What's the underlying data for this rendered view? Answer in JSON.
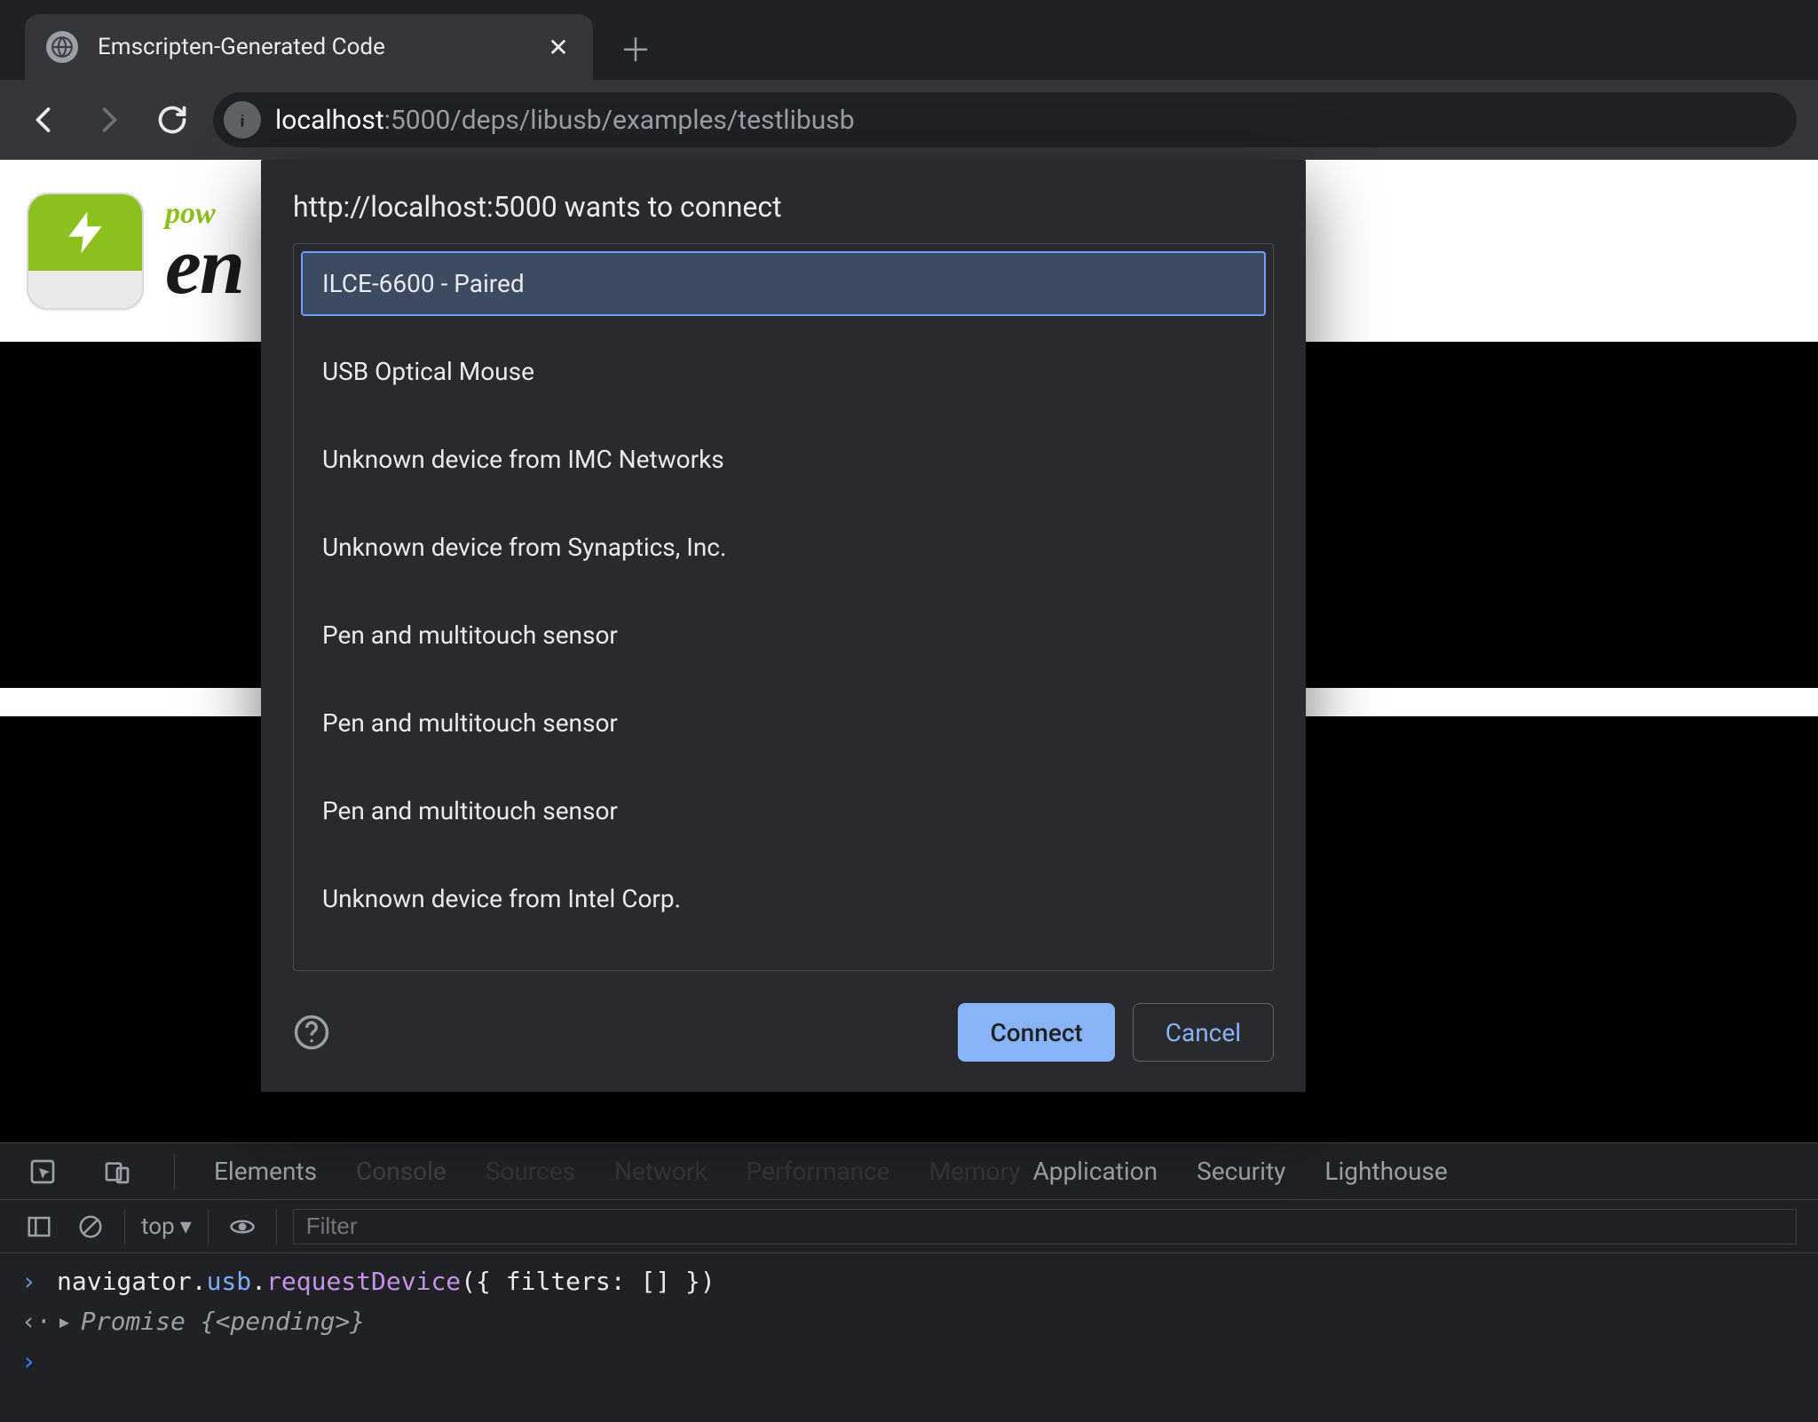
{
  "tab": {
    "title": "Emscripten-Generated Code"
  },
  "url": {
    "host": "localhost",
    "port_path": ":5000/deps/libusb/examples/testlibusb"
  },
  "page": {
    "powered_prefix": "pow",
    "em_prefix": "en"
  },
  "dialog": {
    "title": "http://localhost:5000 wants to connect",
    "devices": [
      "ILCE-6600 - Paired",
      "USB Optical Mouse",
      "Unknown device from IMC Networks",
      "Unknown device from Synaptics, Inc.",
      "Pen and multitouch sensor",
      "Pen and multitouch sensor",
      "Pen and multitouch sensor",
      "Unknown device from Intel Corp."
    ],
    "selected_index": 0,
    "connect_label": "Connect",
    "cancel_label": "Cancel"
  },
  "devtools": {
    "tabs": [
      "Elements",
      "Console",
      "Sources",
      "Network",
      "Performance",
      "Memory",
      "Application",
      "Security",
      "Lighthouse"
    ],
    "active_tab": "Console",
    "context": "top",
    "filter_placeholder": "Filter",
    "console": {
      "input": {
        "obj": "navigator",
        "dot1": ".",
        "prop": "usb",
        "dot2": ".",
        "method": "requestDevice",
        "args": "({ filters: [] })"
      },
      "output_prefix": "Promise ",
      "output_state": "{<pending>}"
    }
  }
}
